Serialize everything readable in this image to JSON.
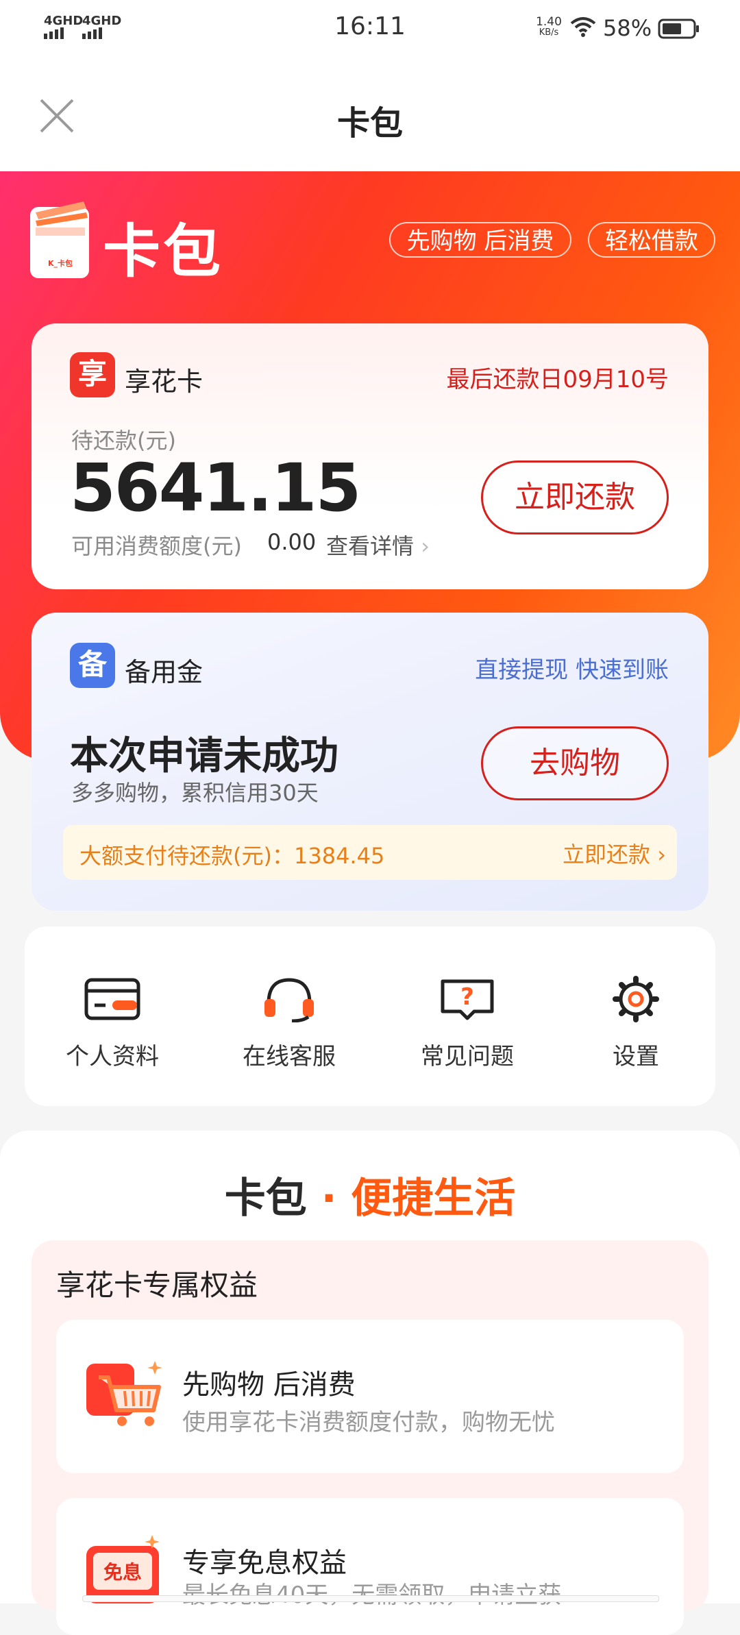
{
  "status_bar": {
    "network_1": "4GHD",
    "network_2": "4GHD",
    "time": "16:11",
    "speed_value": "1.40",
    "speed_unit": "KB/s",
    "battery_percent": "58%"
  },
  "header": {
    "title": "卡包"
  },
  "hero": {
    "brand_title": "卡包",
    "logo_text": "K_卡包",
    "tags": [
      "先购物 后消费",
      "轻松借款"
    ]
  },
  "credit_card": {
    "icon_char": "享",
    "name": "享花卡",
    "due_date": "最后还款日09月10号",
    "pending_label": "待还款(元)",
    "pending_amount": "5641.15",
    "available_label": "可用消费额度(元)",
    "available_amount": "0.00",
    "detail_link": "查看详情",
    "repay_button": "立即还款"
  },
  "reserve_card": {
    "icon_char": "备",
    "name": "备用金",
    "promo": "直接提现 快速到账",
    "status_title": "本次申请未成功",
    "status_desc": "多多购物，累积信用30天",
    "shop_button": "去购物",
    "notice_label": "大额支付待还款(元)：",
    "notice_amount": "1384.45",
    "notice_action": "立即还款"
  },
  "quick_menu": {
    "items": [
      {
        "label": "个人资料",
        "icon": "id-card-icon"
      },
      {
        "label": "在线客服",
        "icon": "headset-icon"
      },
      {
        "label": "常见问题",
        "icon": "faq-icon"
      },
      {
        "label": "设置",
        "icon": "gear-icon"
      }
    ]
  },
  "life_section": {
    "title_part1": "卡包",
    "title_dot": "·",
    "title_part2": "便捷生活",
    "benefits_title": "享花卡专属权益",
    "benefits": [
      {
        "title": "先购物 后消费",
        "desc": "使用享花卡消费额度付款，购物无忧",
        "icon": "shopping-cart-icon"
      },
      {
        "title": "专享免息权益",
        "desc": "最长免息40天，无需领取，申请立获",
        "icon": "interest-free-icon",
        "icon_text": "免息"
      }
    ]
  },
  "colors": {
    "accent_red": "#d6201b",
    "brand_orange": "#ff5a10",
    "link_blue": "#4a6fd0",
    "notice_orange": "#e8801a"
  }
}
